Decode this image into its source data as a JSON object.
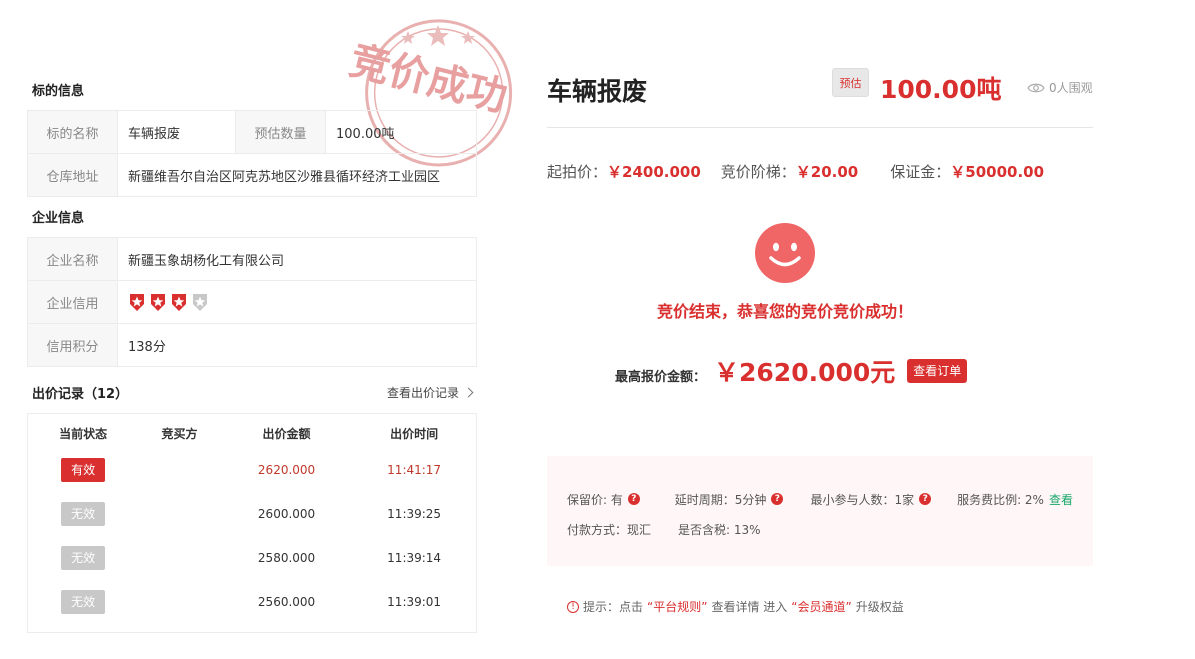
{
  "stamp": {
    "text": "竞价成功"
  },
  "lot": {
    "section_title": "标的信息",
    "name_label": "标的名称",
    "name_value": "车辆报废",
    "qty_label": "预估数量",
    "qty_value": "100.00吨",
    "addr_label": "仓库地址",
    "addr_value": "新疆维吾尔自治区阿克苏地区沙雅县循环经济工业园区"
  },
  "company": {
    "section_title": "企业信息",
    "name_label": "企业名称",
    "name_value": "新疆玉象胡杨化工有限公司",
    "credit_label": "企业信用",
    "credit_level": 3,
    "credit_max": 4,
    "score_label": "信用积分",
    "score_value": "138分"
  },
  "bids": {
    "title": "出价记录（12）",
    "more_label": "查看出价记录",
    "columns": [
      "当前状态",
      "竞买方",
      "出价金额",
      "出价时间"
    ],
    "rows": [
      {
        "status": "有效",
        "valid": true,
        "bidder": "",
        "amount": "2620.000",
        "time": "11:41:17"
      },
      {
        "status": "无效",
        "valid": false,
        "bidder": "",
        "amount": "2600.000",
        "time": "11:39:25"
      },
      {
        "status": "无效",
        "valid": false,
        "bidder": "",
        "amount": "2580.000",
        "time": "11:39:14"
      },
      {
        "status": "无效",
        "valid": false,
        "bidder": "",
        "amount": "2560.000",
        "time": "11:39:01"
      }
    ]
  },
  "header": {
    "title": "车辆报废",
    "est_tag": "预估",
    "qty": "100.00吨",
    "watchers": "0人围观"
  },
  "prices": {
    "start_label": "起拍价：",
    "start_value": "￥2400.000",
    "step_label": "竞价阶梯：",
    "step_value": "￥20.00",
    "deposit_label": "保证金：",
    "deposit_value": "￥50000.00"
  },
  "result": {
    "message": "竞价结束，恭喜您的竞价竞价成功！",
    "top_label": "最高报价金额：",
    "top_amount": "￥2620.000元",
    "order_button": "查看订单"
  },
  "rules": {
    "reserve": "保留价: 有",
    "delay": "延时周期：5分钟",
    "min_participants": "最小参与人数：1家",
    "service_fee": "服务费比例: 2%",
    "service_fee_link": "查看",
    "payment": "付款方式：现汇",
    "tax": "是否含税: 13%"
  },
  "tip": {
    "prefix": "提示：点击",
    "rules_link": "“平台规则”",
    "middle": "查看详情 进入",
    "member_link": "“会员通道”",
    "suffix": "升级权益"
  },
  "colors": {
    "accent": "#d9302f",
    "green": "#1aa86b"
  }
}
